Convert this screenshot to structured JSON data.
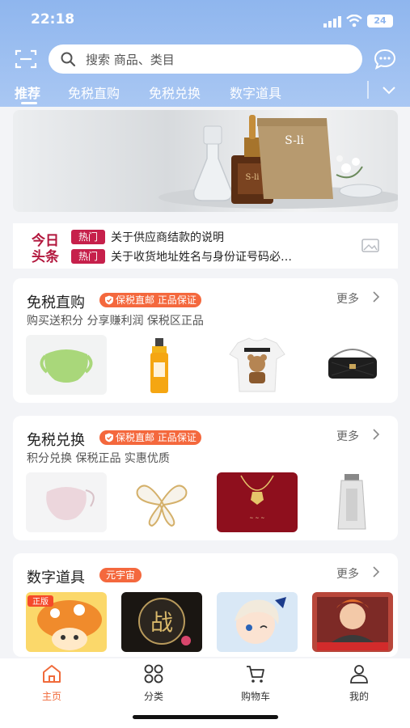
{
  "status_bar": {
    "time": "22:18",
    "battery": "24"
  },
  "search": {
    "placeholder": "搜索 商品、类目"
  },
  "tabs": [
    {
      "label": "推荐",
      "active": true
    },
    {
      "label": "免税直购"
    },
    {
      "label": "免税兑换"
    },
    {
      "label": "数字道具"
    }
  ],
  "banner": {
    "brand_text": "S-li"
  },
  "news": {
    "logo_text": [
      "今日",
      "头条"
    ],
    "items": [
      {
        "tag": "热门",
        "text": "关于供应商结款的说明"
      },
      {
        "tag": "热门",
        "text": "关于收货地址姓名与身份证号码必…"
      }
    ]
  },
  "sections": [
    {
      "title": "免税直购",
      "badge": "保税直邮 正品保证",
      "more": "更多",
      "subtitle": "购买送积分 分享赚利润 保税区正品",
      "products": [
        "green-face-mask",
        "sunscreen-spray-bottle",
        "moschino-teddy-tshirt",
        "black-quilted-handbag"
      ]
    },
    {
      "title": "免税兑换",
      "badge": "保税直邮 正品保证",
      "more": "更多",
      "subtitle": "积分兑换 保税正品 实惠优质",
      "products": [
        "pink-face-mask",
        "butterfly-brooch",
        "gold-necklace",
        "toothpaste-tube"
      ]
    },
    {
      "title": "数字道具",
      "badge": "元宇宙",
      "more": "更多",
      "products": [
        "mushroom-game-icon",
        "battle-game-icon",
        "anime-girl-icon",
        "fox-girl-game-icon"
      ],
      "game_labels": {
        "badge_zheng": "正版",
        "zhan": "战"
      }
    }
  ],
  "bottom_nav": [
    {
      "label": "主页",
      "icon": "home-icon",
      "active": true
    },
    {
      "label": "分类",
      "icon": "category-icon"
    },
    {
      "label": "购物车",
      "icon": "cart-icon"
    },
    {
      "label": "我的",
      "icon": "profile-icon"
    }
  ],
  "colors": {
    "header": "#8fb6ee",
    "accent": "#f06a3a",
    "badge": "#f4683d",
    "hot_tag": "#c6204b"
  }
}
